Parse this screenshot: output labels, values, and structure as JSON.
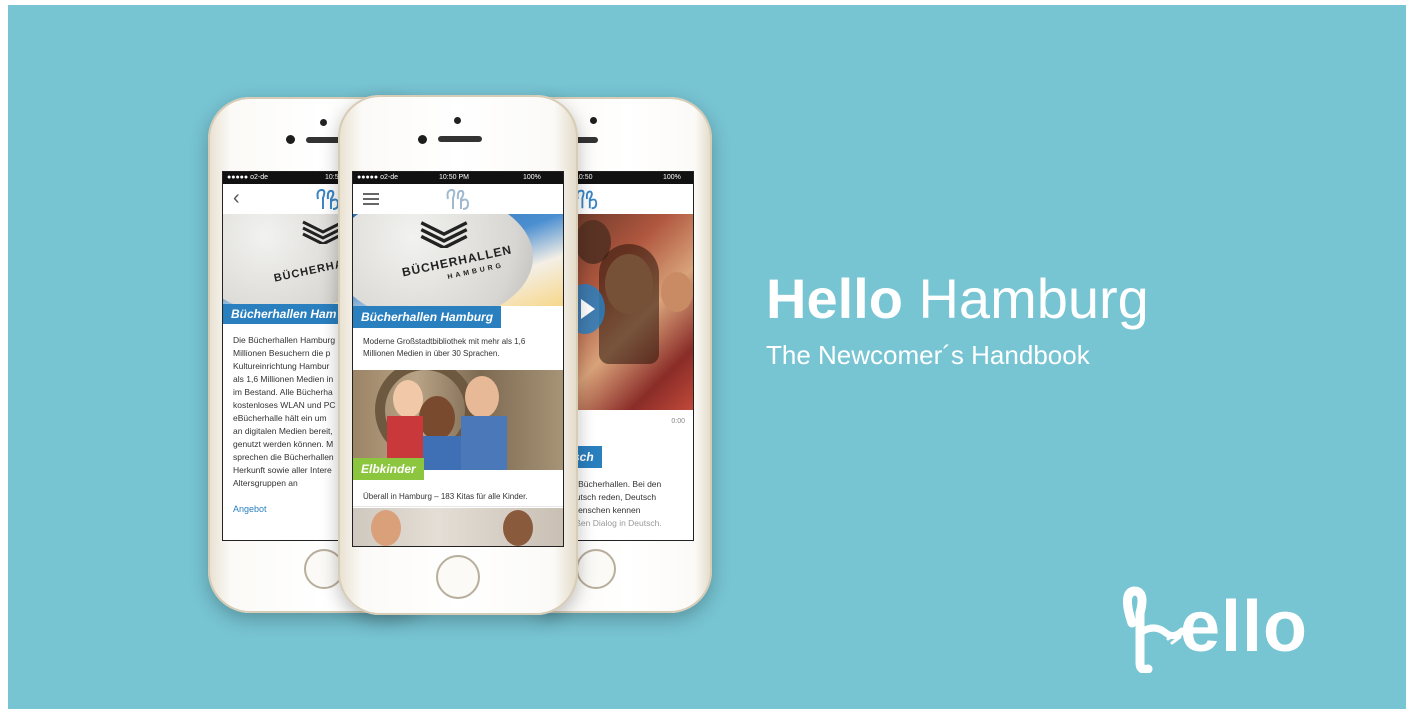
{
  "banner": {
    "title_bold": "Hello",
    "title_rest": " Hamburg",
    "subtitle": "The Newcomer´s Handbook",
    "logo_text": "ello",
    "background_color": "#77c4d3"
  },
  "left_phone": {
    "carrier": "●●●●● o2-de",
    "time": "10:50",
    "back_icon": "chevron-left-icon",
    "tag": "Bücherhallen Ham",
    "body_lines": [
      "Die Bücherhallen Hamburg",
      "Millionen Besuchern die p",
      "Kultureinrichtung Hambur",
      "als 1,6 Millionen Medien in",
      "im Bestand. Alle Bücherha",
      "kostenloses WLAN und PC",
      "eBücherhalle hält ein um",
      "an digitalen Medien bereit,",
      "genutzt werden können. M",
      "sprechen die Bücherhallen",
      "Herkunft sowie aller Intere",
      "Altersgruppen an"
    ],
    "link": "Angebot"
  },
  "center_phone": {
    "carrier": "●●●●● o2-de",
    "time": "10:50 PM",
    "battery": "100%",
    "menu_icon": "hamburger-menu-icon",
    "balloon_line1": "BÜCHERHALLEN",
    "balloon_line2": "HAMBURG",
    "card1": {
      "tag": "Bücherhallen Hamburg",
      "text_line1": "Moderne Großstadtbibliothek mit mehr als 1,6",
      "text_line2": "Millionen Medien in über 30 Sprachen."
    },
    "card2": {
      "tag": "Elbkinder",
      "text": "Überall in Hamburg – 183 Kitas für alle Kinder."
    }
  },
  "right_phone": {
    "time": "10:50",
    "battery": "100%",
    "play_icon": "play-icon",
    "duration": "0:00",
    "tag": "sch",
    "body_lines": [
      "n Bücherhallen. Bei den",
      "eutsch reden, Deutsch",
      "Menschen kennen",
      "eßen Dialog in Deutsch."
    ]
  },
  "colors": {
    "tag_blue": "#2a7fbf",
    "tag_green": "#8cc63f",
    "white": "#ffffff"
  }
}
